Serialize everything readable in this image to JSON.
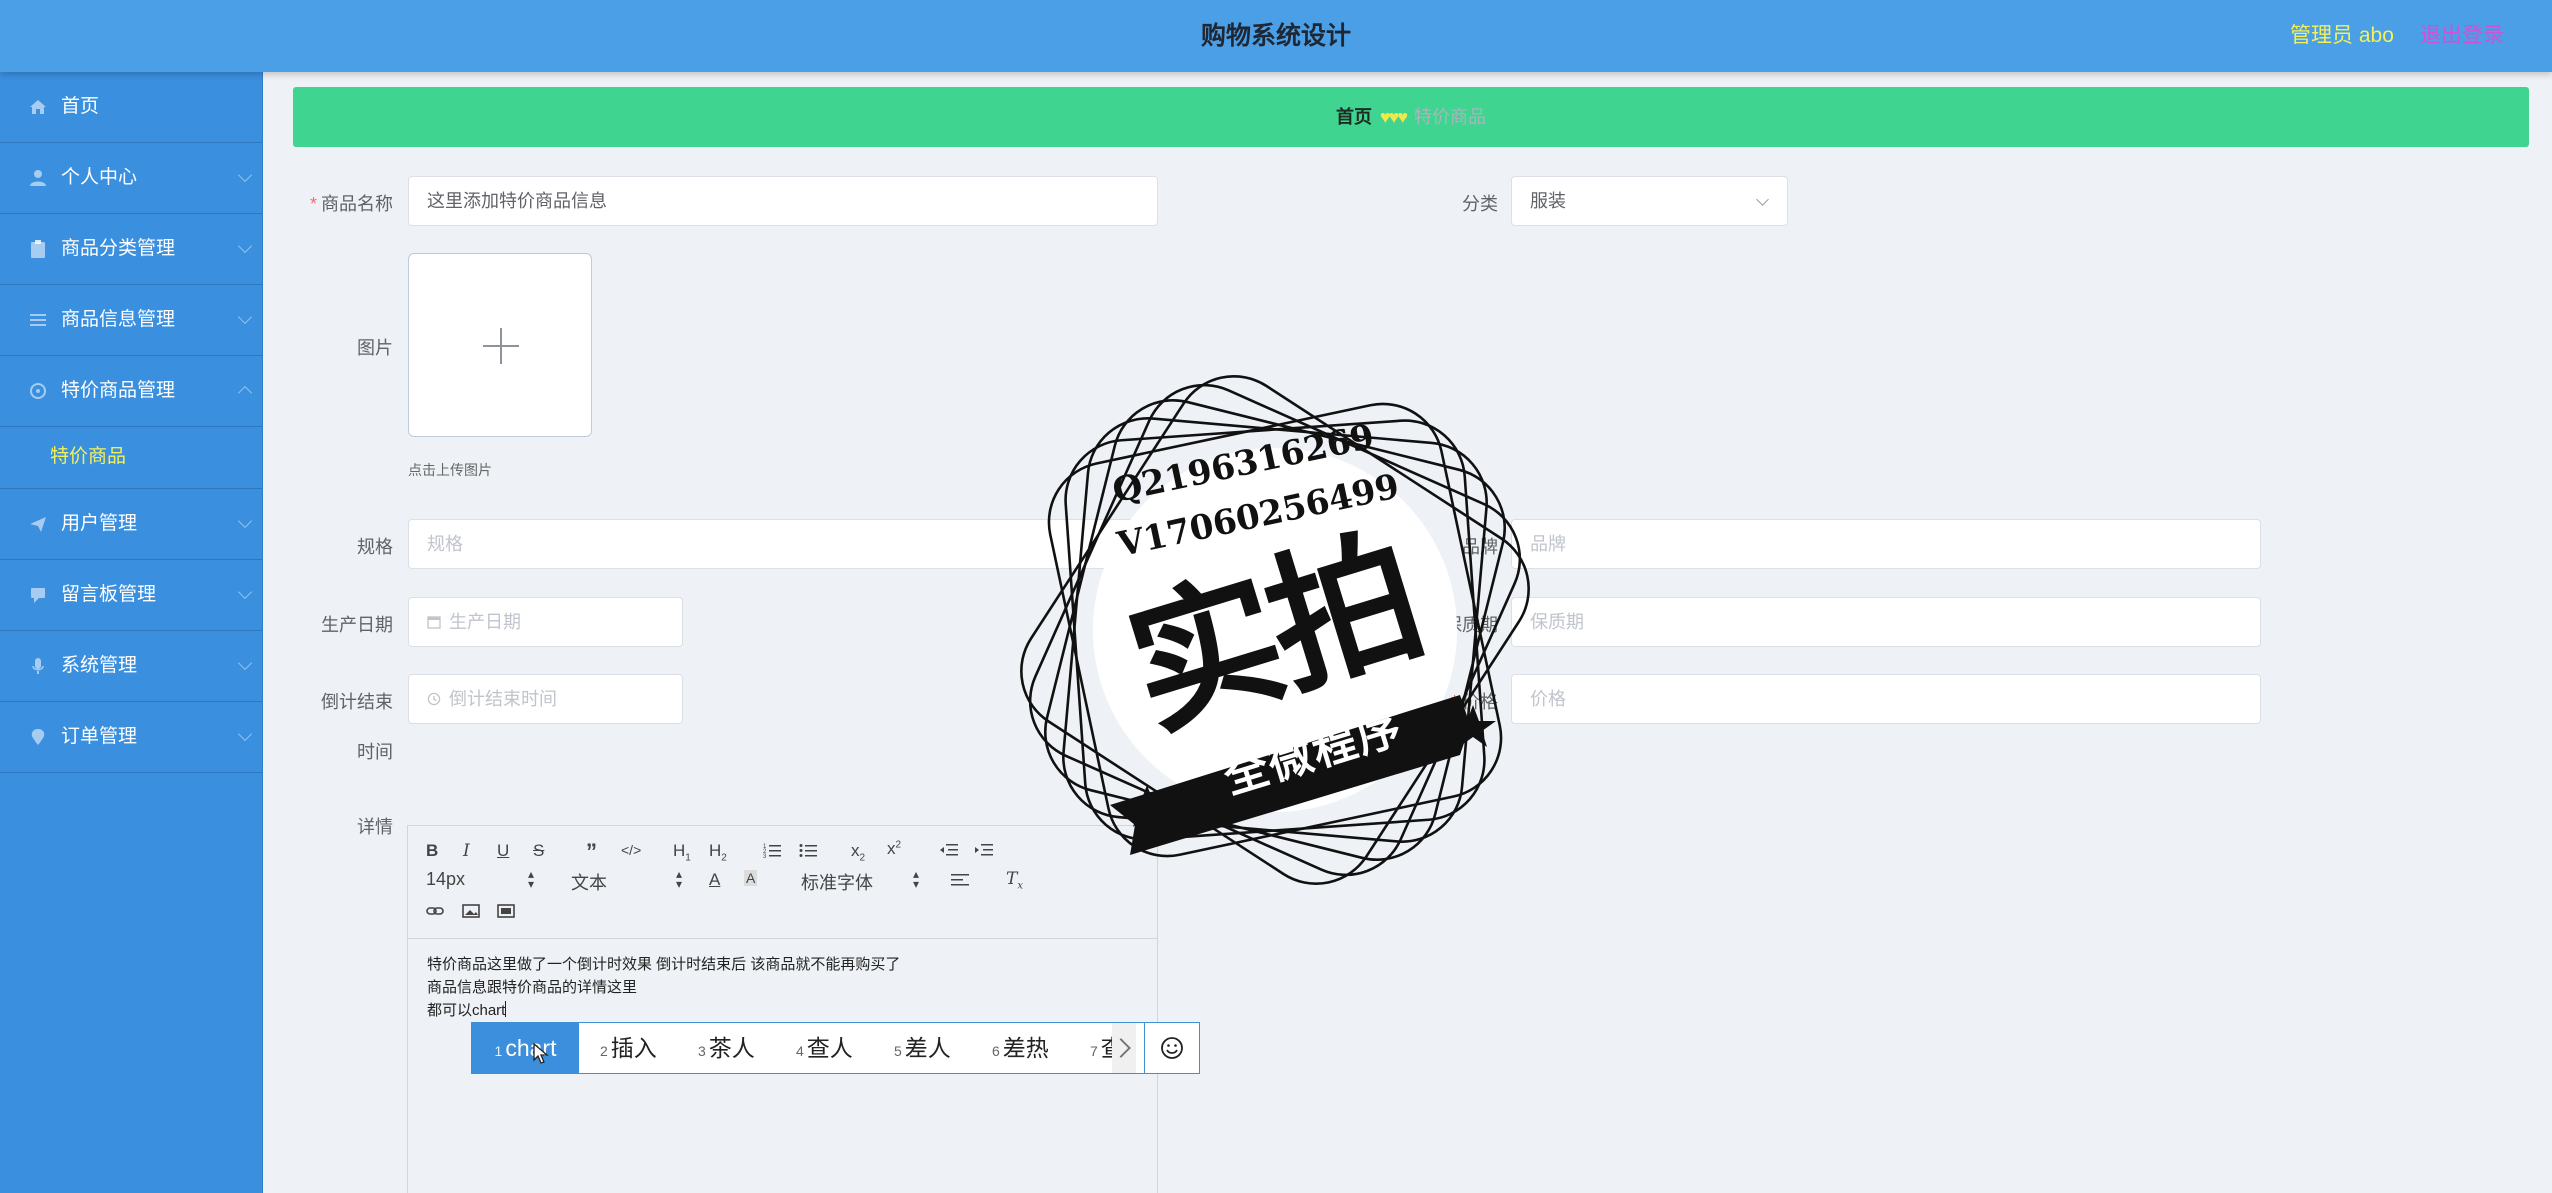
{
  "header": {
    "title": "购物系统设计",
    "admin_label": "管理员 abo",
    "logout_label": "退出登录"
  },
  "sidebar": {
    "items": [
      {
        "label": "首页",
        "icon": "home-icon"
      },
      {
        "label": "个人中心",
        "icon": "user-icon"
      },
      {
        "label": "商品分类管理",
        "icon": "clipboard-icon"
      },
      {
        "label": "商品信息管理",
        "icon": "list-icon"
      },
      {
        "label": "特价商品管理",
        "icon": "settings-icon"
      },
      {
        "label": "用户管理",
        "icon": "send-icon"
      },
      {
        "label": "留言板管理",
        "icon": "comment-icon"
      },
      {
        "label": "系统管理",
        "icon": "mic-icon"
      },
      {
        "label": "订单管理",
        "icon": "location-icon"
      }
    ],
    "subitem": {
      "label": "特价商品"
    }
  },
  "breadcrumb": {
    "home": "首页",
    "hearts": "♥♥♥",
    "current": "特价商品"
  },
  "form": {
    "name_label": "商品名称",
    "name_value": "这里添加特价商品信息",
    "category_label": "分类",
    "category_value": "服装",
    "image_label": "图片",
    "upload_tip": "点击上传图片",
    "spec_label": "规格",
    "spec_placeholder": "规格",
    "brand_label": "品牌",
    "brand_placeholder": "品牌",
    "prod_date_label": "生产日期",
    "prod_date_placeholder": "生产日期",
    "shelf_life_label": "保质期",
    "shelf_life_placeholder": "保质期",
    "countdown_label_1": "倒计结束",
    "countdown_label_2": "时间",
    "countdown_placeholder": "倒计结束时间",
    "price_label": "价格",
    "price_placeholder": "价格",
    "detail_label": "详情"
  },
  "editor": {
    "font_size": "14px",
    "text_type": "文本",
    "font_family": "标准字体",
    "content_lines": [
      "特价商品这里做了一个倒计时效果  倒计时结束后  该商品就不能再购买了",
      "商品信息跟特价商品的详情这里",
      "都可以chart"
    ]
  },
  "ime": {
    "candidates": [
      {
        "num": "1",
        "text": "chart"
      },
      {
        "num": "2",
        "text": "插入"
      },
      {
        "num": "3",
        "text": "茶人"
      },
      {
        "num": "4",
        "text": "查人"
      },
      {
        "num": "5",
        "text": "差人"
      },
      {
        "num": "6",
        "text": "差热"
      },
      {
        "num": "7",
        "text": "查"
      }
    ]
  },
  "watermark": {
    "line1": "Q2196316269",
    "line2": "V17060256499",
    "big": "实拍",
    "banner": "全微程序"
  },
  "colors": {
    "header_bg": "#4b9fe7",
    "sidebar_bg": "#3a8fdf",
    "breadcrumb_bg": "#3fd591",
    "accent_yellow": "#f3f05a",
    "logout_purple": "#d54fd6"
  }
}
